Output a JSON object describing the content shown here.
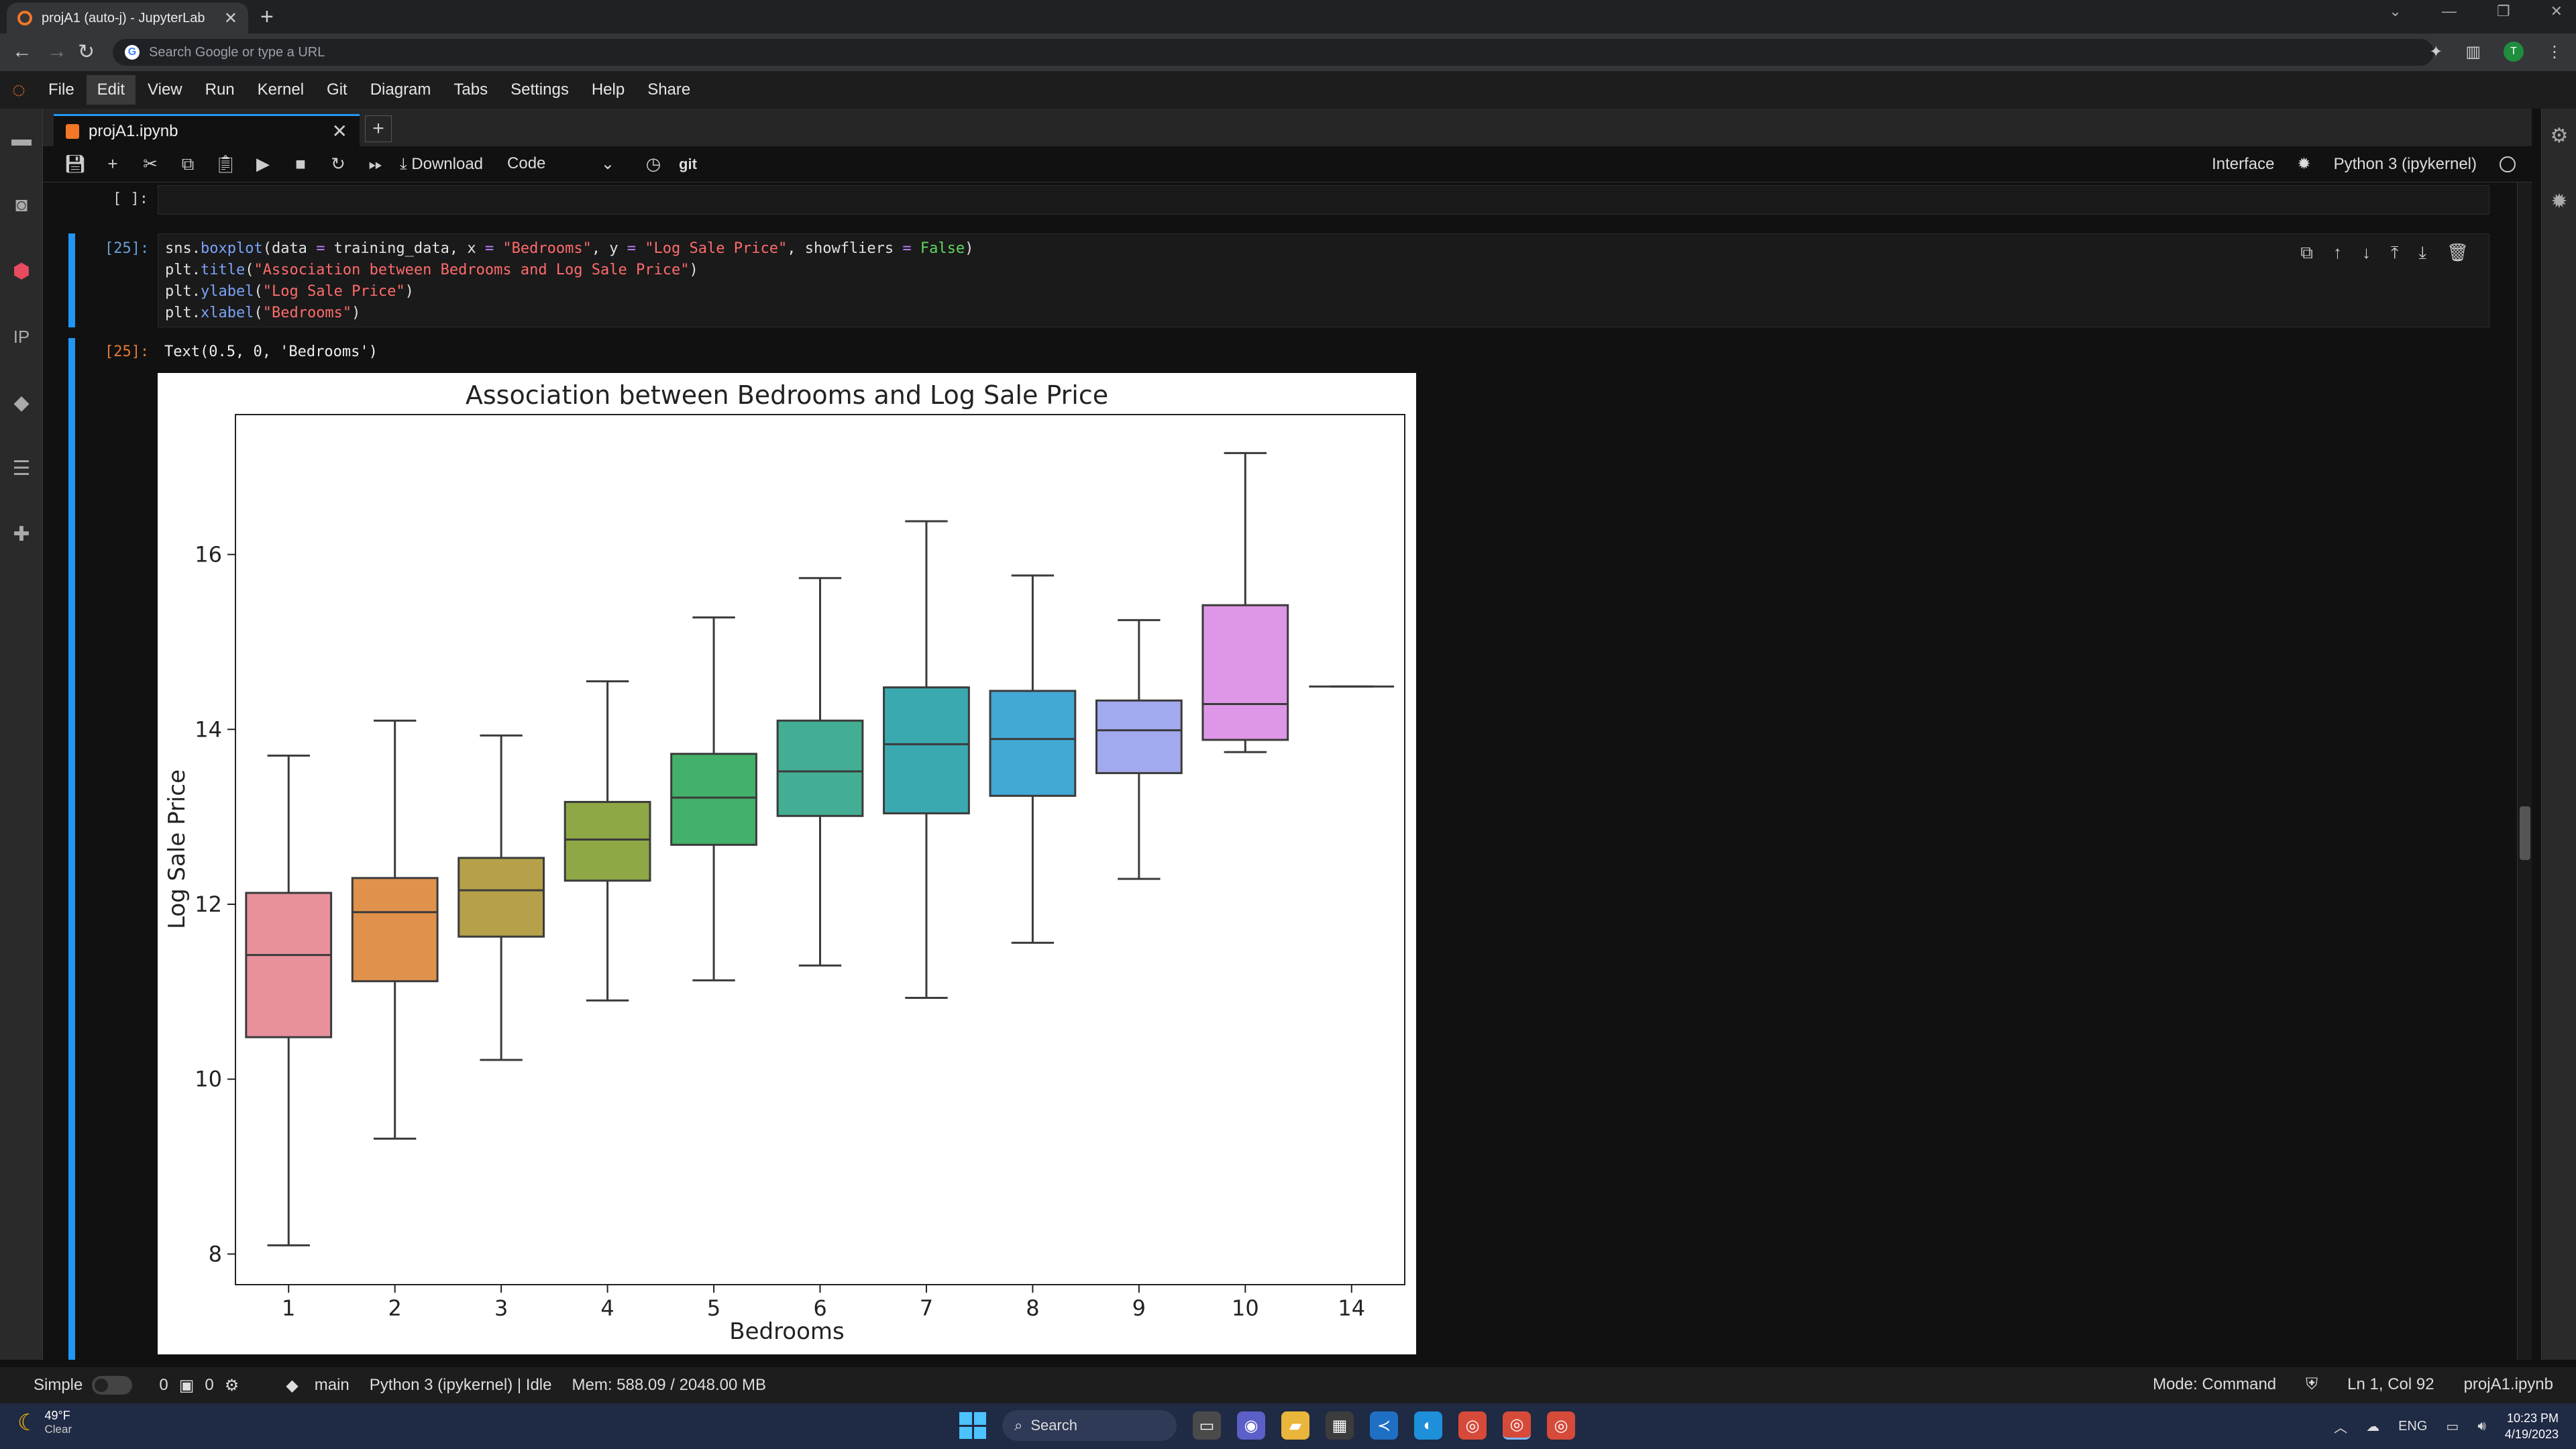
{
  "browser": {
    "tab_title": "projA1 (auto-j) - JupyterLab",
    "address_placeholder": "Search Google or type a URL",
    "profile_initial": "T"
  },
  "menu": [
    "File",
    "Edit",
    "View",
    "Run",
    "Kernel",
    "Git",
    "Diagram",
    "Tabs",
    "Settings",
    "Help",
    "Share"
  ],
  "notebook_tab": {
    "label": "projA1.ipynb"
  },
  "toolbar": {
    "download_label": "Download",
    "cell_type": "Code",
    "git_label": "git",
    "interface_label": "Interface",
    "kernel_label": "Python 3 (ipykernel)"
  },
  "cells": {
    "empty_prompt": "[ ]:",
    "code_prompt": "[25]:",
    "output_prompt": "[25]:",
    "code_lines": [
      "sns.boxplot(data = training_data, x = \"Bedrooms\", y = \"Log Sale Price\", showfliers = False)",
      "plt.title(\"Association between Bedrooms and Log Sale Price\")",
      "plt.ylabel(\"Log Sale Price\")",
      "plt.xlabel(\"Bedrooms\")"
    ],
    "output_text": "Text(0.5, 0, 'Bedrooms')"
  },
  "chart_data": {
    "type": "boxplot",
    "title": "Association between Bedrooms and Log Sale Price",
    "xlabel": "Bedrooms",
    "ylabel": "Log Sale Price",
    "ylim": [
      7.65,
      17.6
    ],
    "yticks": [
      8,
      10,
      12,
      14,
      16
    ],
    "categories": [
      "1",
      "2",
      "3",
      "4",
      "5",
      "6",
      "7",
      "8",
      "9",
      "10",
      "14"
    ],
    "boxes": [
      {
        "x": "1",
        "whislo": 8.1,
        "q1": 10.48,
        "med": 11.42,
        "q3": 12.13,
        "whishi": 13.7,
        "color": "#e8919c"
      },
      {
        "x": "2",
        "whislo": 9.32,
        "q1": 11.12,
        "med": 11.91,
        "q3": 12.3,
        "whishi": 14.1,
        "color": "#e0924c"
      },
      {
        "x": "3",
        "whislo": 10.22,
        "q1": 11.63,
        "med": 12.16,
        "q3": 12.53,
        "whishi": 13.93,
        "color": "#b6a14a"
      },
      {
        "x": "4",
        "whislo": 10.9,
        "q1": 12.27,
        "med": 12.74,
        "q3": 13.17,
        "whishi": 14.55,
        "color": "#8ea846"
      },
      {
        "x": "5",
        "whislo": 11.13,
        "q1": 12.68,
        "med": 13.22,
        "q3": 13.72,
        "whishi": 15.28,
        "color": "#44b16a"
      },
      {
        "x": "6",
        "whislo": 11.3,
        "q1": 13.01,
        "med": 13.52,
        "q3": 14.1,
        "whishi": 15.73,
        "color": "#44ae94"
      },
      {
        "x": "7",
        "whislo": 10.93,
        "q1": 13.04,
        "med": 13.83,
        "q3": 14.48,
        "whishi": 16.38,
        "color": "#3aaab0"
      },
      {
        "x": "8",
        "whislo": 11.56,
        "q1": 13.24,
        "med": 13.89,
        "q3": 14.44,
        "whishi": 15.76,
        "color": "#42a8d4"
      },
      {
        "x": "9",
        "whislo": 12.29,
        "q1": 13.5,
        "med": 13.99,
        "q3": 14.33,
        "whishi": 15.25,
        "color": "#a3a9ee"
      },
      {
        "x": "10",
        "whislo": 13.74,
        "q1": 13.88,
        "med": 14.29,
        "q3": 15.42,
        "whishi": 17.16,
        "color": "#de97e6"
      },
      {
        "x": "14",
        "whislo": 14.49,
        "q1": 14.49,
        "med": 14.49,
        "q3": 14.49,
        "whishi": 14.49,
        "color": "#e8919c"
      }
    ]
  },
  "status": {
    "mode_simple": "Simple",
    "count_a": "0",
    "count_b": "0",
    "branch": "main",
    "kernel_status": "Python 3 (ipykernel) | Idle",
    "memory": "Mem: 588.09 / 2048.00 MB",
    "mode": "Mode: Command",
    "cursor": "Ln 1, Col 92",
    "file": "projA1.ipynb"
  },
  "taskbar": {
    "temp": "49°F",
    "weather": "Clear",
    "search": "Search",
    "lang": "ENG",
    "time": "10:23 PM",
    "date": "4/19/2023"
  }
}
